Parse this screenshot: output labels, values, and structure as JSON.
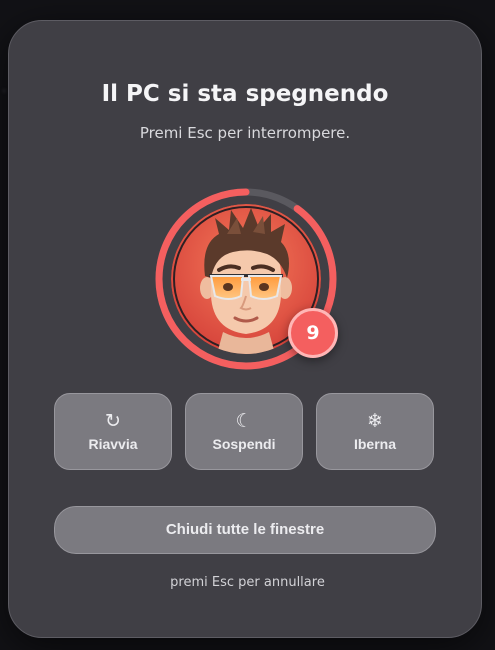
{
  "dialog": {
    "title": "Il PC si sta spegnendo",
    "subtitle": "Premi Esc per interrompere.",
    "countdown": "9",
    "countdown_progress": 0.9,
    "actions": [
      {
        "label": "Riavvia",
        "icon": "restart-icon"
      },
      {
        "label": "Sospendi",
        "icon": "moon-icon"
      },
      {
        "label": "Iberna",
        "icon": "snowflake-icon"
      }
    ],
    "close_all_label": "Chiudi tutte le finestre",
    "cancel_hint": "premi Esc per annullare"
  },
  "colors": {
    "accent": "#f45f5f",
    "dialog_bg": "#403f45",
    "button_bg": "#7b7a80"
  }
}
